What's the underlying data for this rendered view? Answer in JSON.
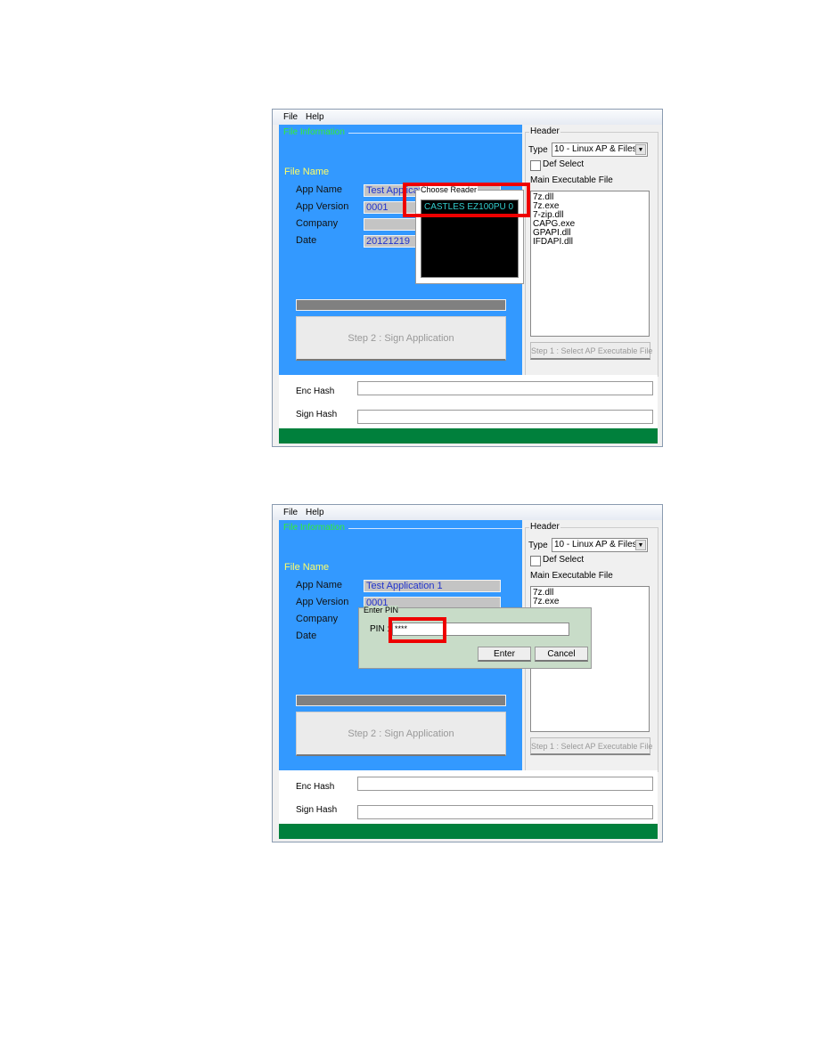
{
  "app": {
    "menu": [
      "File",
      "Help"
    ],
    "file_info_legend": "File Information",
    "file_name_label": "File Name",
    "labels": {
      "app_name": "App Name",
      "app_version": "App Version",
      "company": "Company",
      "date": "Date"
    },
    "sign_button": "Step 2 : Sign Application",
    "header_legend": "Header",
    "type_label": "Type",
    "type_value": "10 - Linux AP & Files",
    "def_select": "Def Select",
    "main_exec_label": "Main Executable File",
    "step1_button": "Step 1 : Select AP Executable File",
    "enc_hash_label": "Enc Hash",
    "sign_hash_label": "Sign Hash"
  },
  "screens": [
    {
      "fields": {
        "app_name": "Test Application 1",
        "app_version": "0001",
        "company": "",
        "date": "20121219"
      },
      "files": [
        "7z.dll",
        "7z.exe",
        "7-zip.dll",
        "CAPG.exe",
        "GPAPI.dll",
        "IFDAPI.dll"
      ],
      "dialog": {
        "title": "Choose Reader",
        "items": [
          "CASTLES EZ100PU 0"
        ]
      }
    },
    {
      "fields": {
        "app_name": "Test Application 1",
        "app_version": "0001",
        "company": "",
        "date": ""
      },
      "files": [
        "7z.dll",
        "7z.exe"
      ],
      "dialog": {
        "title": "Enter PIN",
        "pin_label": "PIN :",
        "pin_value": "****",
        "enter": "Enter",
        "cancel": "Cancel"
      }
    }
  ],
  "colors": {
    "panel": "#3399ff",
    "status_bar": "#00803c",
    "highlight": "#ee0000"
  }
}
